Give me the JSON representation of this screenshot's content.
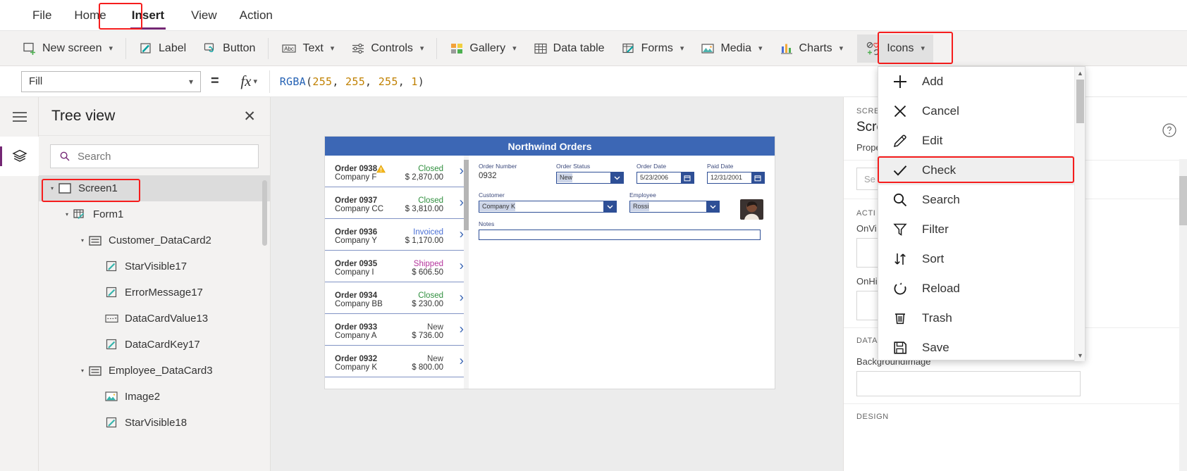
{
  "menubar": {
    "items": [
      {
        "label": "File",
        "active": false
      },
      {
        "label": "Home",
        "active": false
      },
      {
        "label": "Insert",
        "active": true
      },
      {
        "label": "View",
        "active": false
      },
      {
        "label": "Action",
        "active": false
      }
    ]
  },
  "ribbon": {
    "items": [
      {
        "label": "New screen",
        "icon": "new-screen-icon",
        "caret": true
      },
      {
        "label": "Label",
        "icon": "label-icon",
        "caret": false
      },
      {
        "label": "Button",
        "icon": "button-icon",
        "caret": false
      },
      {
        "label": "Text",
        "icon": "text-abc-icon",
        "caret": true
      },
      {
        "label": "Controls",
        "icon": "controls-sliders-icon",
        "caret": true
      },
      {
        "label": "Gallery",
        "icon": "gallery-grid-icon",
        "caret": true
      },
      {
        "label": "Data table",
        "icon": "data-table-icon",
        "caret": false
      },
      {
        "label": "Forms",
        "icon": "forms-icon",
        "caret": true
      },
      {
        "label": "Media",
        "icon": "media-image-icon",
        "caret": true
      },
      {
        "label": "Charts",
        "icon": "charts-bar-icon",
        "caret": true
      },
      {
        "label": "Icons",
        "icon": "icons-shapes-icon",
        "caret": true,
        "selected": true
      }
    ]
  },
  "formula_bar": {
    "property": "Fill",
    "equals": "=",
    "fx_label": "fx",
    "formula_fn": "RGBA",
    "formula_open": "(",
    "formula_args": [
      "255",
      "255",
      "255",
      "1"
    ],
    "formula_close": ")",
    "formula_full": "RGBA(255, 255, 255, 1)"
  },
  "tree_view": {
    "title": "Tree view",
    "close_label": "✕",
    "search_placeholder": "Search",
    "rows": [
      {
        "label": "Screen1",
        "indent": 0,
        "icon": "screen-icon",
        "twisty": true,
        "selected": true
      },
      {
        "label": "Form1",
        "indent": 1,
        "icon": "form-icon",
        "twisty": true,
        "selected": false
      },
      {
        "label": "Customer_DataCard2",
        "indent": 2,
        "icon": "datacard-icon",
        "twisty": true,
        "selected": false
      },
      {
        "label": "StarVisible17",
        "indent": 3,
        "icon": "label-pencil-icon",
        "twisty": false,
        "selected": false
      },
      {
        "label": "ErrorMessage17",
        "indent": 3,
        "icon": "label-pencil-icon",
        "twisty": false,
        "selected": false
      },
      {
        "label": "DataCardValue13",
        "indent": 3,
        "icon": "dropdown-value-icon",
        "twisty": false,
        "selected": false
      },
      {
        "label": "DataCardKey17",
        "indent": 3,
        "icon": "label-pencil-icon",
        "twisty": false,
        "selected": false
      },
      {
        "label": "Employee_DataCard3",
        "indent": 2,
        "icon": "datacard-icon",
        "twisty": true,
        "selected": false
      },
      {
        "label": "Image2",
        "indent": 3,
        "icon": "image-icon",
        "twisty": false,
        "selected": false
      },
      {
        "label": "StarVisible18",
        "indent": 3,
        "icon": "label-pencil-icon",
        "twisty": false,
        "selected": false
      }
    ]
  },
  "canvas_app": {
    "title": "Northwind Orders",
    "gallery": [
      {
        "order": "Order 0938",
        "company": "Company F",
        "status": "Closed",
        "status_color": "#2f8f3e",
        "amount": "$ 2,870.00",
        "warning": true
      },
      {
        "order": "Order 0937",
        "company": "Company CC",
        "status": "Closed",
        "status_color": "#2f8f3e",
        "amount": "$ 3,810.00",
        "warning": false
      },
      {
        "order": "Order 0936",
        "company": "Company Y",
        "status": "Invoiced",
        "status_color": "#4a6fd4",
        "amount": "$ 1,170.00",
        "warning": false
      },
      {
        "order": "Order 0935",
        "company": "Company I",
        "status": "Shipped",
        "status_color": "#b5359c",
        "amount": "$ 606.50",
        "warning": false
      },
      {
        "order": "Order 0934",
        "company": "Company BB",
        "status": "Closed",
        "status_color": "#2f8f3e",
        "amount": "$ 230.00",
        "warning": false
      },
      {
        "order": "Order 0933",
        "company": "Company A",
        "status": "New",
        "status_color": "#444444",
        "amount": "$ 736.00",
        "warning": false
      },
      {
        "order": "Order 0932",
        "company": "Company K",
        "status": "New",
        "status_color": "#444444",
        "amount": "$ 800.00",
        "warning": false
      }
    ],
    "form": {
      "order_number_label": "Order Number",
      "order_number_value": "0932",
      "order_status_label": "Order Status",
      "order_status_value": "New",
      "order_date_label": "Order Date",
      "order_date_value": "5/23/2006",
      "paid_date_label": "Paid Date",
      "paid_date_value": "12/31/2001",
      "customer_label": "Customer",
      "customer_value": "Company K",
      "employee_label": "Employee",
      "employee_value": "Rossi",
      "notes_label": "Notes",
      "notes_value": ""
    }
  },
  "icons_flyout": {
    "items": [
      {
        "label": "Add",
        "icon": "plus-icon",
        "highlighted": false
      },
      {
        "label": "Cancel",
        "icon": "close-x-icon",
        "highlighted": false
      },
      {
        "label": "Edit",
        "icon": "pencil-icon",
        "highlighted": false
      },
      {
        "label": "Check",
        "icon": "check-icon",
        "highlighted": true
      },
      {
        "label": "Search",
        "icon": "magnifier-icon",
        "highlighted": false
      },
      {
        "label": "Filter",
        "icon": "funnel-icon",
        "highlighted": false
      },
      {
        "label": "Sort",
        "icon": "sort-arrows-icon",
        "highlighted": false
      },
      {
        "label": "Reload",
        "icon": "refresh-icon",
        "highlighted": false
      },
      {
        "label": "Trash",
        "icon": "trash-icon",
        "highlighted": false
      },
      {
        "label": "Save",
        "icon": "floppy-disk-icon",
        "highlighted": false
      }
    ],
    "scroll_up": "▲",
    "scroll_down": "▼"
  },
  "properties_pane": {
    "section_caption": "SCREEN",
    "screen_name": "Scre",
    "properties_tab": "Prope",
    "search_placeholder": "Se",
    "action_caption": "ACTI",
    "onvisible_label": "OnVi",
    "onhidden_label": "OnHi",
    "data_caption": "DATA",
    "background_image_label": "BackgroundImage",
    "background_image_value": "",
    "design_caption": "DESIGN",
    "help_icon": "help-circle-icon"
  },
  "colors": {
    "accent_purple": "#742774",
    "highlight_red": "#f61d1d",
    "app_blue": "#3c67b5",
    "form_border_blue": "#2e4f96"
  }
}
